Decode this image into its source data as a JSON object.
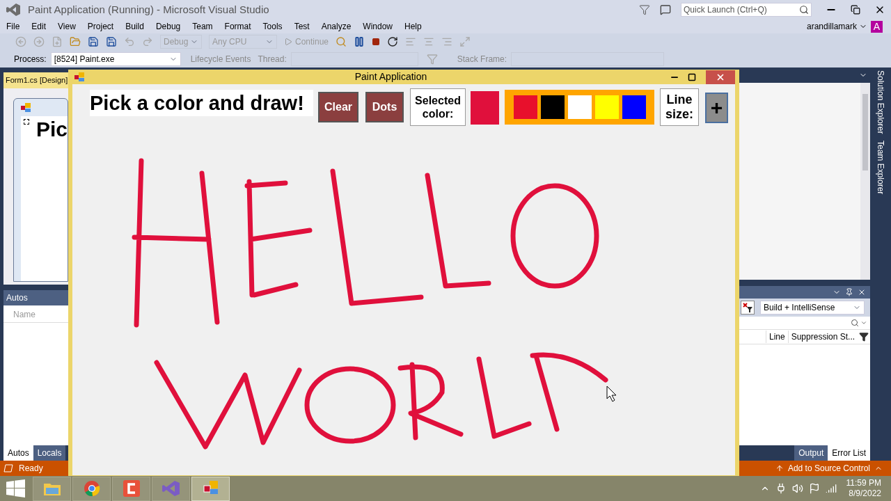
{
  "window": {
    "title": "Paint Application (Running) - Microsoft Visual Studio"
  },
  "quick_launch": {
    "placeholder": "Quick Launch (Ctrl+Q)"
  },
  "menu": [
    "File",
    "Edit",
    "View",
    "Project",
    "Build",
    "Debug",
    "Team",
    "Format",
    "Tools",
    "Test",
    "Analyze",
    "Window",
    "Help"
  ],
  "account": {
    "user": "arandillamark",
    "initial": "A"
  },
  "toolbar": {
    "configuration": "Debug",
    "platform": "Any CPU",
    "continue": "Continue"
  },
  "debug_location": {
    "process_label": "Process:",
    "process": "[8524] Paint.exe",
    "lifecycle": "Lifecycle Events",
    "thread_label": "Thread:",
    "stack_frame_label": "Stack Frame:"
  },
  "designer": {
    "tab": "Form1.cs [Design]",
    "form_text": "Pic"
  },
  "autos": {
    "title": "Autos",
    "columns": [
      "Name"
    ],
    "tabs": [
      {
        "label": "Autos",
        "selected": true
      },
      {
        "label": "Locals",
        "selected": false
      }
    ]
  },
  "side_tabs": [
    "Solution Explorer",
    "Team Explorer"
  ],
  "error_list": {
    "scope": "Build + IntelliSense",
    "columns": [
      "Line",
      "Suppression St..."
    ],
    "tabs": [
      {
        "label": "Output",
        "selected": false
      },
      {
        "label": "Error List",
        "selected": true
      }
    ]
  },
  "status_bar": {
    "state": "Ready",
    "source_control": "Add to Source Control"
  },
  "paint_window": {
    "title": "Paint Application",
    "heading": "Pick a color and draw!",
    "buttons": [
      "Clear",
      "Dots"
    ],
    "selected_color_label": "Selected color:",
    "selected_swatch": {
      "color": "#e0103c"
    },
    "palette": [
      {
        "color": "#e8102c"
      },
      {
        "color": "#000000"
      },
      {
        "color": "#ffffff"
      },
      {
        "color": "#ffff00"
      },
      {
        "color": "#0000ff"
      }
    ],
    "line_size_label": "Line size:",
    "line_size_button": "+"
  },
  "taskbar": {
    "apps": [
      {
        "kind": "folder",
        "selected": false
      },
      {
        "kind": "browser",
        "selected": false
      },
      {
        "kind": "recorder",
        "selected": false
      },
      {
        "kind": "studio",
        "selected": false
      },
      {
        "kind": "paint",
        "selected": true
      }
    ],
    "time": "11:59 PM",
    "date": "8/9/2022"
  }
}
